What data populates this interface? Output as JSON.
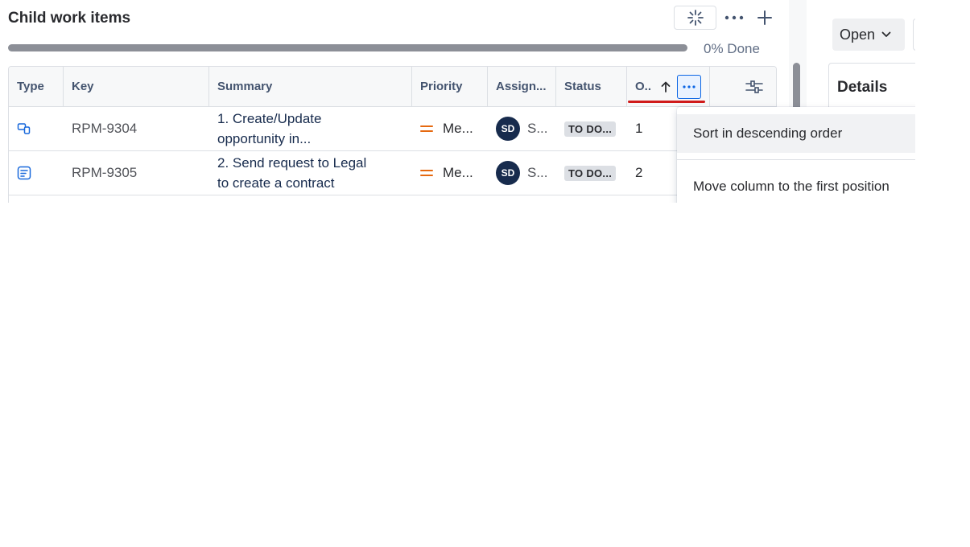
{
  "section": {
    "title": "Child work items"
  },
  "progress": {
    "percent": 0,
    "label": "0% Done"
  },
  "table": {
    "columns": [
      {
        "key": "type",
        "label": "Type"
      },
      {
        "key": "key",
        "label": "Key"
      },
      {
        "key": "summary",
        "label": "Summary"
      },
      {
        "key": "priority",
        "label": "Priority"
      },
      {
        "key": "assignee",
        "label": "Assign..."
      },
      {
        "key": "status",
        "label": "Status"
      },
      {
        "key": "order",
        "label": "O.."
      }
    ],
    "rows": [
      {
        "type_icon": "subtask-icon",
        "key": "RPM-9304",
        "summary": "1. Create/Update opportunity in...",
        "priority": "Me...",
        "assignee_initials": "SD",
        "assignee_name": "S...",
        "status": "TO DO...",
        "order": "1"
      },
      {
        "type_icon": "task-icon",
        "key": "RPM-9305",
        "summary": "2. Send request to Legal to create a contract",
        "priority": "Me...",
        "assignee_initials": "SD",
        "assignee_name": "S...",
        "status": "TO DO...",
        "order": "2"
      }
    ]
  },
  "context_menu": {
    "items": [
      {
        "label": "Sort in descending order"
      },
      {
        "label": "Move column to the first position"
      }
    ]
  },
  "side_panel": {
    "open_button": "Open",
    "details_title": "Details"
  },
  "colors": {
    "accent": "#0c66e4",
    "priority_medium": "#e56910",
    "annotation_underline": "#d01b1b",
    "avatar_bg": "#172b4d"
  }
}
